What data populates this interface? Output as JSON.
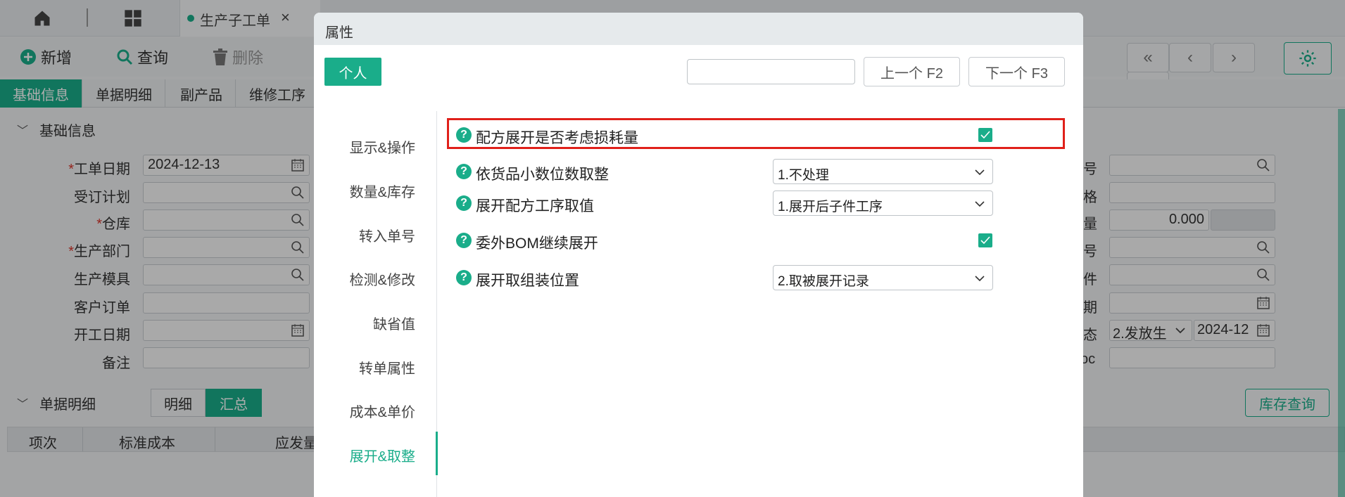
{
  "window": {
    "doc_tab": {
      "label": "生产子工单",
      "close": "×"
    }
  },
  "toolbar": {
    "add_label": "新增",
    "query_label": "查询",
    "delete_label": "删除",
    "nav": {
      "first": "«",
      "prev": "‹",
      "next": "›",
      "last": "»"
    }
  },
  "tabs": [
    "基础信息",
    "单据明细",
    "副产品",
    "维修工序"
  ],
  "basic_section": {
    "title": "基础信息",
    "fields": {
      "work_date": {
        "label": "工单日期",
        "value": "2024-12-13",
        "required": true
      },
      "order_plan": {
        "label": "受订计划",
        "value": ""
      },
      "warehouse": {
        "label": "仓库",
        "value": "",
        "required": true
      },
      "dept": {
        "label": "生产部门",
        "value": "",
        "required": true
      },
      "mold": {
        "label": "生产模具",
        "value": ""
      },
      "customer_order": {
        "label": "客户订单",
        "value": ""
      },
      "start_date": {
        "label": "开工日期",
        "value": ""
      },
      "remark": {
        "label": "备注",
        "value": ""
      }
    },
    "right_fields": {
      "r1_suffix": "号",
      "r2_suffix": "格",
      "r3_suffix": "量",
      "r3_value": "0.000",
      "r4_suffix": "号",
      "r5_suffix": "件",
      "r6_suffix": "期",
      "r7_suffix": "态",
      "r7_select": "2.发放生",
      "r7_date": "2024-12",
      "r8_suffix": "oc"
    }
  },
  "detail_section": {
    "title": "单据明细",
    "segments": [
      "明细",
      "汇总"
    ],
    "active_segment": "汇总",
    "stock_query": "库存查询",
    "columns": [
      "项次",
      "标准成本",
      "应发量"
    ]
  },
  "dialog": {
    "title": "属性",
    "personal_tab": "个人",
    "search_placeholder": "",
    "prev_button": "上一个 F2",
    "next_button": "下一个 F3",
    "nav": [
      "显示&操作",
      "数量&库存",
      "转入单号",
      "检测&修改",
      "缺省值",
      "转单属性",
      "成本&单价",
      "展开&取整"
    ],
    "active_nav": "展开&取整",
    "options": [
      {
        "label": "配方展开是否考虑损耗量",
        "type": "checkbox",
        "checked": true,
        "highlighted": true
      },
      {
        "label": "依货品小数位数取整",
        "type": "select",
        "value": "1.不处理"
      },
      {
        "label": "展开配方工序取值",
        "type": "select",
        "value": "1.展开后子件工序"
      },
      {
        "label": "委外BOM继续展开",
        "type": "checkbox",
        "checked": true
      },
      {
        "label": "展开取组装位置",
        "type": "select",
        "value": "2.取被展开记录"
      }
    ],
    "help_glyph": "?"
  },
  "colors": {
    "accent": "#1aad8a",
    "highlight": "#e0201a",
    "required": "#d9352b"
  }
}
